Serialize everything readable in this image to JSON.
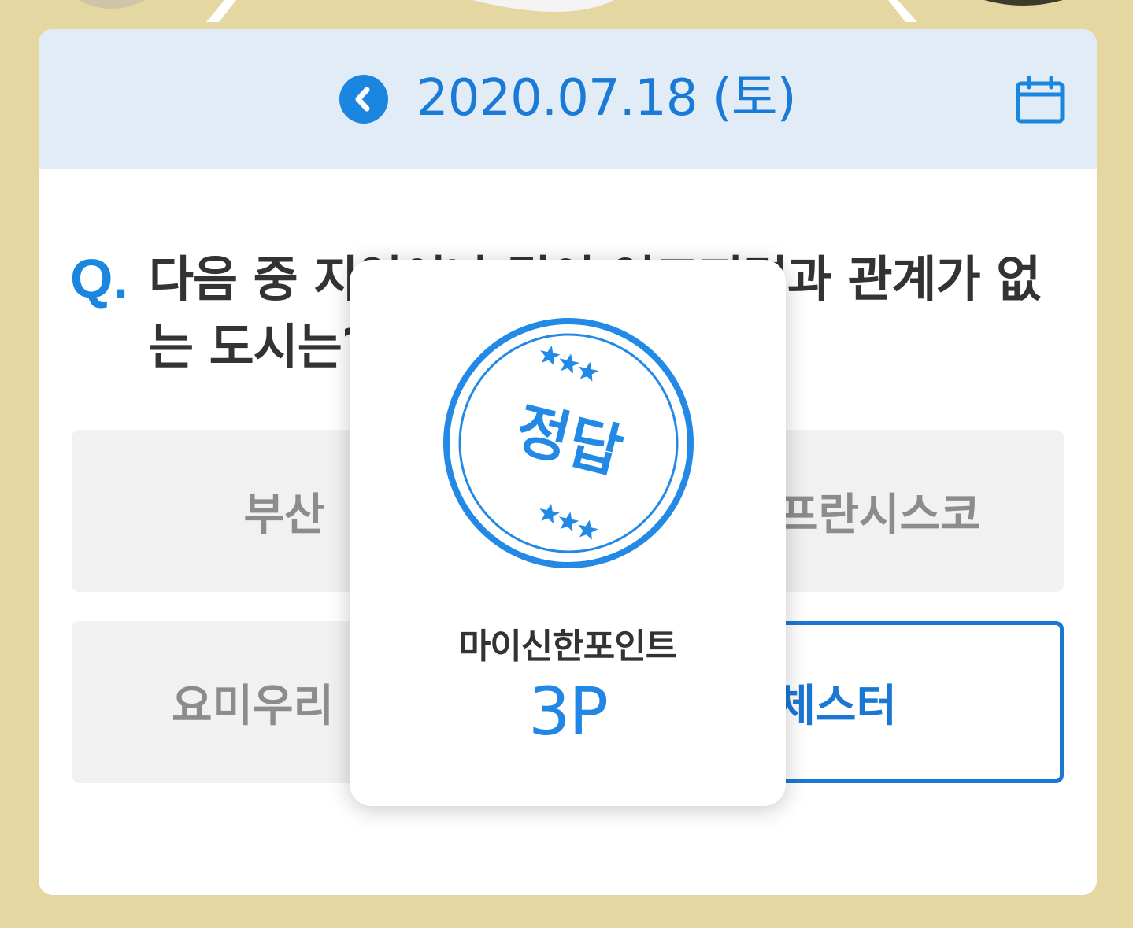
{
  "header": {
    "date": "2020.07.18 (토)",
    "prev_icon": "chevron-left-icon",
    "calendar_icon": "calendar-icon"
  },
  "question": {
    "mark": "Q.",
    "text": "다음 중 지역이나 팀이 연고지명과 관계가 없는 도시는?"
  },
  "options": [
    {
      "label": "부산"
    },
    {
      "label": "샌프란시스코"
    },
    {
      "label": "요미우리"
    },
    {
      "label": "맨체스터"
    }
  ],
  "popup": {
    "stamp_text": "정답",
    "point_label": "마이신한포인트",
    "point_value": "3P"
  },
  "colors": {
    "brand_blue": "#1a86e0",
    "background": "#e4d7a2",
    "header_bg": "#e2ecf7"
  }
}
